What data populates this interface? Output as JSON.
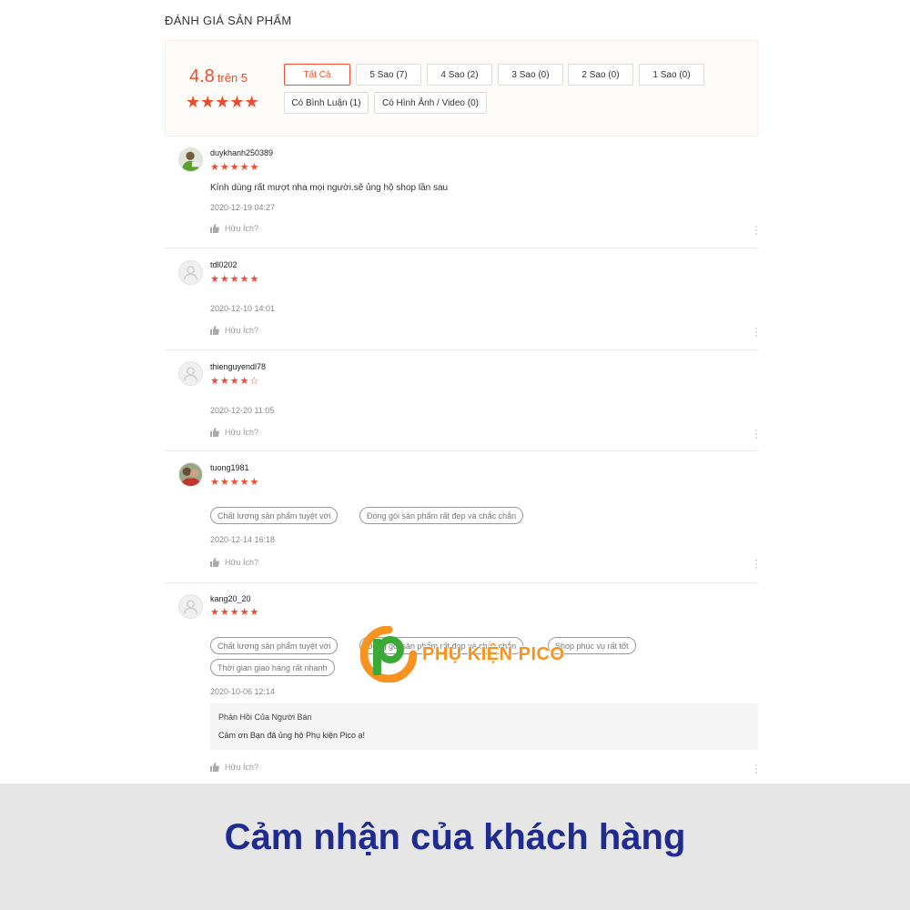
{
  "page": {
    "title": "ĐÁNH GIÁ SẢN PHẨM"
  },
  "summary": {
    "score": "4.8",
    "score_suffix": "trên 5",
    "stars": "★★★★★"
  },
  "filters": [
    {
      "label": "Tất Cả",
      "active": true
    },
    {
      "label": "5 Sao (7)",
      "active": false
    },
    {
      "label": "4 Sao (2)",
      "active": false
    },
    {
      "label": "3 Sao (0)",
      "active": false
    },
    {
      "label": "2 Sao (0)",
      "active": false
    },
    {
      "label": "1 Sao (0)",
      "active": false
    },
    {
      "label": "Có Bình Luận (1)",
      "active": false
    },
    {
      "label": "Có Hình Ảnh / Video (0)",
      "active": false
    }
  ],
  "reviews": [
    {
      "username": "duykhanh250389",
      "stars": "★★★★★",
      "comment": "Kính dùng rất mượt nha mọi người.sẽ ủng hộ shop lần sau",
      "date": "2020-12-19 04:27",
      "helpful": "Hữu Ích?",
      "avatar": "photo"
    },
    {
      "username": "tdl0202",
      "stars": "★★★★★",
      "date": "2020-12-10 14:01",
      "helpful": "Hữu Ích?",
      "avatar": "default"
    },
    {
      "username": "thienguyendl78",
      "stars": "★★★★☆",
      "date": "2020-12-20 11:05",
      "helpful": "Hữu Ích?",
      "avatar": "default"
    },
    {
      "username": "tuong1981",
      "stars": "★★★★★",
      "tags": [
        "Chất lượng sản phẩm tuyệt vời",
        "Đóng gói sản phẩm rất đẹp và chắc chắn"
      ],
      "date": "2020-12-14 16:18",
      "helpful": "Hữu Ích?",
      "avatar": "photo"
    },
    {
      "username": "kang20_20",
      "stars": "★★★★★",
      "tags": [
        "Chất lượng sản phẩm tuyệt vời",
        "Đóng gói sản phẩm rất đẹp và chắc chắn",
        "Shop phục vụ rất tốt",
        "Thời gian giao hàng rất nhanh"
      ],
      "date": "2020-10-06 12:14",
      "seller_reply_title": "Phản Hồi Của Người Bán",
      "seller_reply_text": "Cảm ơn Bạn đã ủng hộ Phụ kiện Pico ạ!",
      "helpful": "Hữu Ích?",
      "avatar": "default"
    }
  ],
  "watermark": {
    "text": "PHỤ KIỆN PICO",
    "color": "#f7931e"
  },
  "footer": {
    "caption": "Cảm nhận của khách hàng"
  },
  "colors": {
    "accent": "#ee4d2d",
    "caption": "#1e2b8f"
  }
}
